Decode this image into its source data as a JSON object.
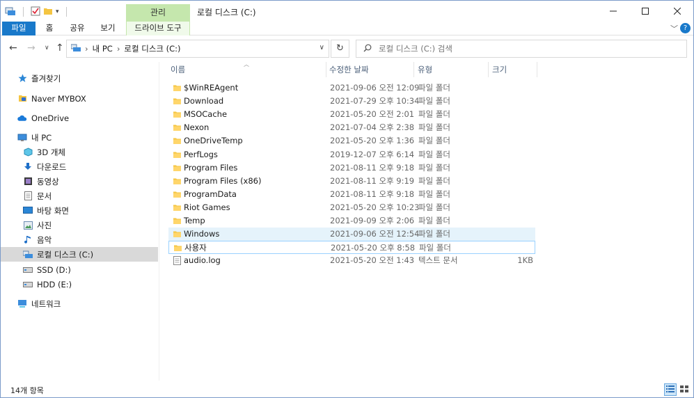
{
  "window": {
    "title": "로컬 디스크 (C:)"
  },
  "ribbon": {
    "context_label": "관리",
    "tabs": {
      "file": "파일",
      "home": "홈",
      "share": "공유",
      "view": "보기",
      "drive_tools": "드라이브 도구"
    }
  },
  "address": {
    "crumbs": [
      "내 PC",
      "로컬 디스크 (C:)"
    ],
    "search_placeholder": "로컬 디스크 (C:) 검색"
  },
  "sidebar": {
    "items": [
      {
        "label": "즐겨찾기",
        "icon": "star-icon"
      },
      {
        "label": "Naver MYBOX",
        "icon": "mybox-icon"
      },
      {
        "label": "OneDrive",
        "icon": "cloud-icon"
      },
      {
        "label": "내 PC",
        "icon": "computer-icon"
      },
      {
        "label": "3D 개체",
        "icon": "cube-icon"
      },
      {
        "label": "다운로드",
        "icon": "download-icon"
      },
      {
        "label": "동영상",
        "icon": "video-icon"
      },
      {
        "label": "문서",
        "icon": "document-icon"
      },
      {
        "label": "바탕 화면",
        "icon": "desktop-icon"
      },
      {
        "label": "사진",
        "icon": "picture-icon"
      },
      {
        "label": "음악",
        "icon": "music-icon"
      },
      {
        "label": "로컬 디스크 (C:)",
        "icon": "drive-icon"
      },
      {
        "label": "SSD (D:)",
        "icon": "drive-icon"
      },
      {
        "label": "HDD (E:)",
        "icon": "drive-icon"
      },
      {
        "label": "네트워크",
        "icon": "network-icon"
      }
    ]
  },
  "columns": {
    "name": "이름",
    "date": "수정한 날짜",
    "type": "유형",
    "size": "크기"
  },
  "files": [
    {
      "name": "$WinREAgent",
      "date": "2021-09-06 오전 12:09",
      "type": "파일 폴더",
      "size": ""
    },
    {
      "name": "Download",
      "date": "2021-07-29 오후 10:34",
      "type": "파일 폴더",
      "size": ""
    },
    {
      "name": "MSOCache",
      "date": "2021-05-20 오전 2:01",
      "type": "파일 폴더",
      "size": ""
    },
    {
      "name": "Nexon",
      "date": "2021-07-04 오후 2:38",
      "type": "파일 폴더",
      "size": ""
    },
    {
      "name": "OneDriveTemp",
      "date": "2021-05-20 오후 1:36",
      "type": "파일 폴더",
      "size": ""
    },
    {
      "name": "PerfLogs",
      "date": "2019-12-07 오후 6:14",
      "type": "파일 폴더",
      "size": ""
    },
    {
      "name": "Program Files",
      "date": "2021-08-11 오후 9:18",
      "type": "파일 폴더",
      "size": ""
    },
    {
      "name": "Program Files (x86)",
      "date": "2021-08-11 오후 9:19",
      "type": "파일 폴더",
      "size": ""
    },
    {
      "name": "ProgramData",
      "date": "2021-08-11 오후 9:18",
      "type": "파일 폴더",
      "size": ""
    },
    {
      "name": "Riot Games",
      "date": "2021-05-20 오후 10:23",
      "type": "파일 폴더",
      "size": ""
    },
    {
      "name": "Temp",
      "date": "2021-09-09 오후 2:06",
      "type": "파일 폴더",
      "size": ""
    },
    {
      "name": "Windows",
      "date": "2021-09-06 오전 12:54",
      "type": "파일 폴더",
      "size": ""
    },
    {
      "name": "사용자",
      "date": "2021-05-20 오후 8:58",
      "type": "파일 폴더",
      "size": ""
    },
    {
      "name": "audio.log",
      "date": "2021-05-20 오전 1:43",
      "type": "텍스트 문서",
      "size": "1KB"
    }
  ],
  "status": {
    "item_count": "14개 항목"
  },
  "colors": {
    "accent": "#1979ca",
    "manage_tab": "#c5e7ad",
    "folder": "#f4c542",
    "hover": "#e5f3fb"
  }
}
